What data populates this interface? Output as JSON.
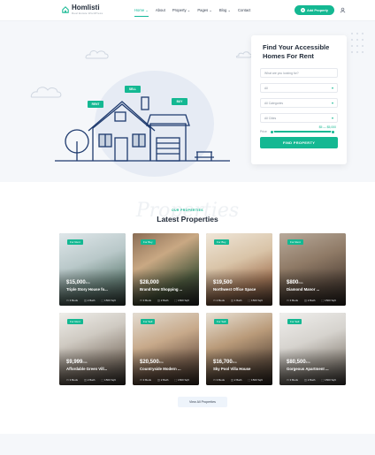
{
  "header": {
    "brand": "Homlisti",
    "tagline": "Real Estate WordPress",
    "nav": [
      "Home",
      "About",
      "Property",
      "Pages",
      "Blog",
      "Contact"
    ],
    "add_label": "Add Property"
  },
  "hero": {
    "tags": [
      "RENT",
      "SELL",
      "BUY"
    ]
  },
  "search": {
    "title_line1": "Find Your Accessible",
    "title_line2": "Homes For Rent",
    "keyword_placeholder": "What are you looking for?",
    "type_value": "All",
    "category_value": "All Categories",
    "city_value": "All Cities",
    "price_label": "Price",
    "price_range": "$5 — $5,000",
    "button_label": "FIND PROPERTY"
  },
  "section": {
    "eyebrow": "OUR PROPERTIES",
    "ghost": "Properties",
    "title": "Latest Properties",
    "view_all": "View All Properties"
  },
  "properties": [
    {
      "badge": "For Rent",
      "price": "$15,000",
      "unit": "/mo",
      "name": "Triple Story House fo...",
      "beds": "3 Beds",
      "baths": "2 Bath",
      "area": "1500 Sqft"
    },
    {
      "badge": "For Buy",
      "price": "$28,000",
      "unit": "",
      "name": "Brand New Shopping ...",
      "beds": "3 Beds",
      "baths": "2 Bath",
      "area": "1500 Sqft"
    },
    {
      "badge": "For Buy",
      "price": "$19,500",
      "unit": "",
      "name": "Northwest Office Space",
      "beds": "2 Beds",
      "baths": "1 Bath",
      "area": "1500 Sqft"
    },
    {
      "badge": "For Rent",
      "price": "$800",
      "unit": "/mo",
      "name": "Diamond Manor ...",
      "beds": "3 Beds",
      "baths": "2 Bath",
      "area": "1500 Sqft"
    },
    {
      "badge": "For Rent",
      "price": "$9,999",
      "unit": "/mo",
      "name": "Affordable Green Vill...",
      "beds": "3 Beds",
      "baths": "2 Bath",
      "area": "1500 Sqft"
    },
    {
      "badge": "For Sell",
      "price": "$20,500",
      "unit": "/mo",
      "name": "Countryside Modern ...",
      "beds": "3 Beds",
      "baths": "2 Bath",
      "area": "1500 Sqft"
    },
    {
      "badge": "For Sell",
      "price": "$16,700",
      "unit": "/mo",
      "name": "Sky Pool Villa House",
      "beds": "3 Beds",
      "baths": "2 Bath",
      "area": "1500 Sqft"
    },
    {
      "badge": "For Sell",
      "price": "$80,500",
      "unit": "/mo",
      "name": "Gorgeous Apartment ...",
      "beds": "3 Beds",
      "baths": "2 Bath",
      "area": "1500 Sqft"
    }
  ],
  "colors": {
    "accent": "#14b892",
    "background": "#f5f7fa",
    "text": "#1f2937"
  }
}
